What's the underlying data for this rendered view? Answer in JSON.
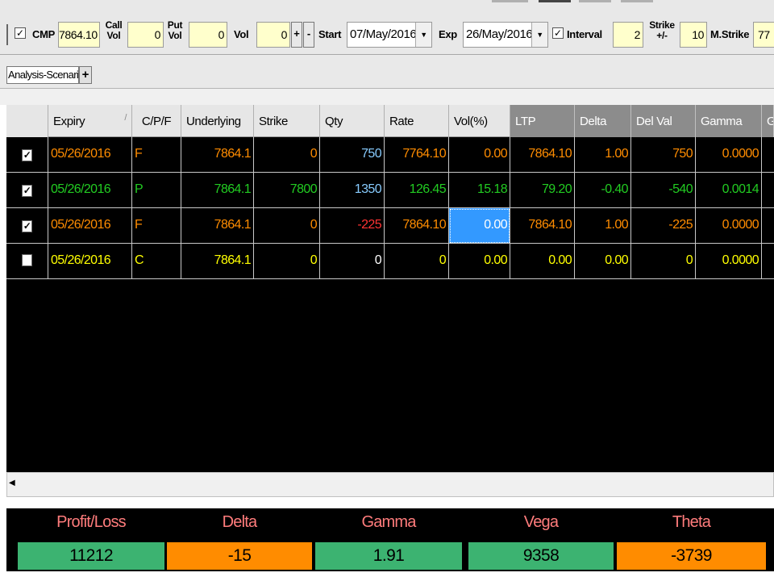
{
  "toolbar": {
    "cmp_checked": "✓",
    "cmp_label": "CMP",
    "cmp_value": "7864.10",
    "call_vol_label1": "Call",
    "call_vol_label2": "Vol",
    "call_vol_value": "0",
    "put_vol_label1": "Put",
    "put_vol_label2": "Vol",
    "put_vol_value": "0",
    "vol_label": "Vol",
    "vol_value": "0",
    "plus": "+",
    "minus": "-",
    "start_label": "Start",
    "start_value": "07/May/2016",
    "exp_label": "Exp",
    "exp_value": "26/May/2016",
    "interval_checked": "✓",
    "interval_label": "Interval",
    "interval_value": "2",
    "strike_pm_label1": "Strike",
    "strike_pm_label2": "+/-",
    "strike_pm_value": "10",
    "mstrike_label": "M.Strike",
    "mstrike_value": "77",
    "dropdown_icon": "▼"
  },
  "tabs": {
    "active_label": "Analysis-Scenario",
    "add_label": "+"
  },
  "grid": {
    "headers": [
      "",
      "Expiry",
      "C/P/F",
      "Underlying",
      "Strike",
      "Qty",
      "Rate",
      "Vol(%)",
      "LTP",
      "Delta",
      "Del Val",
      "Gamma",
      "G"
    ],
    "sort_mark": "/",
    "rows": [
      {
        "checked": "✓",
        "cells": [
          "05/26/2016",
          "F",
          "7864.1",
          "0",
          "750",
          "7764.10",
          "0.00",
          "7864.10",
          "1.00",
          "750",
          "0.0000"
        ]
      },
      {
        "checked": "✓",
        "cells": [
          "05/26/2016",
          "P",
          "7864.1",
          "7800",
          "1350",
          "126.45",
          "15.18",
          "79.20",
          "-0.40",
          "-540",
          "0.0014"
        ]
      },
      {
        "checked": "✓",
        "cells": [
          "05/26/2016",
          "F",
          "7864.1",
          "0",
          "-225",
          "7864.10",
          "0.00",
          "7864.10",
          "1.00",
          "-225",
          "0.0000"
        ]
      },
      {
        "checked": "",
        "cells": [
          "05/26/2016",
          "C",
          "7864.1",
          "0",
          "0",
          "0",
          "0.00",
          "0.00",
          "0.00",
          "0",
          "0.0000"
        ]
      }
    ],
    "colors": {
      "orange": "#ff8c00",
      "green": "#22cc22",
      "yellow": "#ffff00",
      "lightblue": "#88ccff",
      "red": "#ff3333",
      "white": "#ffffff",
      "selected": "#3399ff"
    }
  },
  "scroll": {
    "left_arrow": "◀"
  },
  "summary": {
    "items": [
      {
        "label": "Profit/Loss",
        "value": "11212",
        "color": "#3cb371"
      },
      {
        "label": "Delta",
        "value": "-15",
        "color": "#ff8c00"
      },
      {
        "label": "Gamma",
        "value": "1.91",
        "color": "#3cb371"
      },
      {
        "label": "Vega",
        "value": "9358",
        "color": "#3cb371"
      },
      {
        "label": "Theta",
        "value": "-3739",
        "color": "#ff8c00"
      }
    ]
  }
}
